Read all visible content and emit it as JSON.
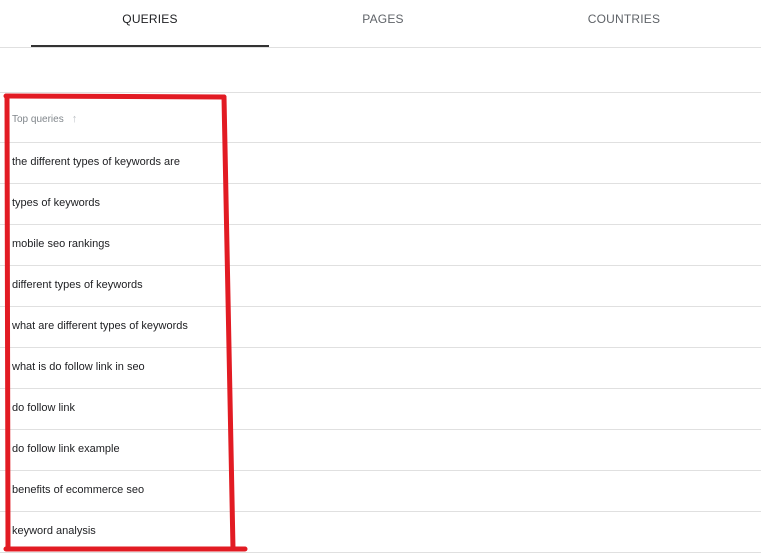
{
  "tabs": [
    {
      "label": "QUERIES",
      "active": true
    },
    {
      "label": "PAGES",
      "active": false
    },
    {
      "label": "COUNTRIES",
      "active": false
    }
  ],
  "table": {
    "header": {
      "label": "Top queries",
      "sort_icon": "arrow-up-icon"
    },
    "rows": [
      "the different types of keywords are",
      "types of keywords",
      "mobile seo rankings",
      "different types of keywords",
      "what are different types of keywords",
      "what is do follow link in seo",
      "do follow link",
      "do follow link example",
      "benefits of ecommerce seo",
      "keyword analysis"
    ]
  },
  "annotation": {
    "color": "#e21b23"
  }
}
